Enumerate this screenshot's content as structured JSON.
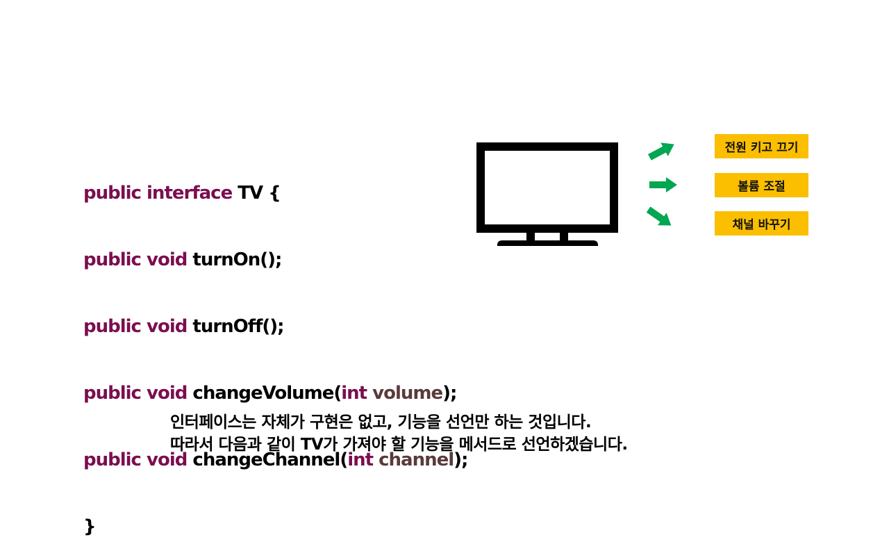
{
  "code": {
    "line1": {
      "kw": "public interface",
      "rest": " TV {"
    },
    "line2": {
      "kw": "public void",
      "rest": " turnOn();"
    },
    "line3": {
      "kw": "public void",
      "rest": " turnOff();"
    },
    "line4": {
      "kw": "public void",
      "pre": " changeVolume(",
      "type": "int",
      "param": " volume",
      "post": ");"
    },
    "line5": {
      "kw": "public void",
      "pre": " changeChannel(",
      "type": "int",
      "param": " channel",
      "post": ");"
    },
    "line6": {
      "text": "}"
    }
  },
  "diagram": {
    "icon": "tv-icon",
    "arrow_color": "#00a651",
    "label_color": "#fbbf00",
    "labels": [
      "전원 키고 끄기",
      "볼륨 조절",
      "채널 바꾸기"
    ]
  },
  "caption": {
    "line1": "인터페이스는 자체가 구현은 없고, 기능을 선언만 하는 것입니다.",
    "line2": "따라서 다음과 같이 TV가 가져야 할 기능을 메서드로 선언하겠습니다."
  }
}
